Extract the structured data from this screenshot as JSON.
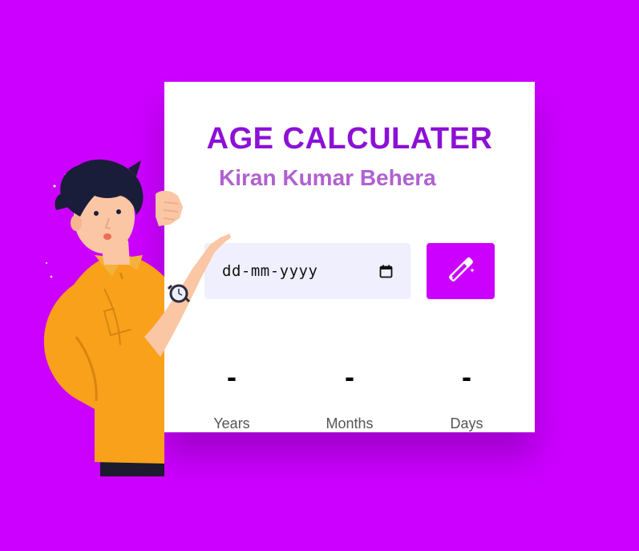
{
  "card": {
    "title": "AGE CALCULATER",
    "subtitle": "Kiran Kumar Behera"
  },
  "date_input": {
    "placeholder": "dd-mm-yyyy",
    "icon": "calendar-icon"
  },
  "calculate_button": {
    "icon": "magic-wand-icon"
  },
  "results": [
    {
      "value": "-",
      "label": "Years"
    },
    {
      "value": "-",
      "label": "Months"
    },
    {
      "value": "-",
      "label": "Days"
    }
  ],
  "colors": {
    "background": "#cc00ff",
    "title": "#8d10d6",
    "subtitle": "#b061d0",
    "input_bg": "#efeffd",
    "button_bg": "#cc00ff"
  }
}
